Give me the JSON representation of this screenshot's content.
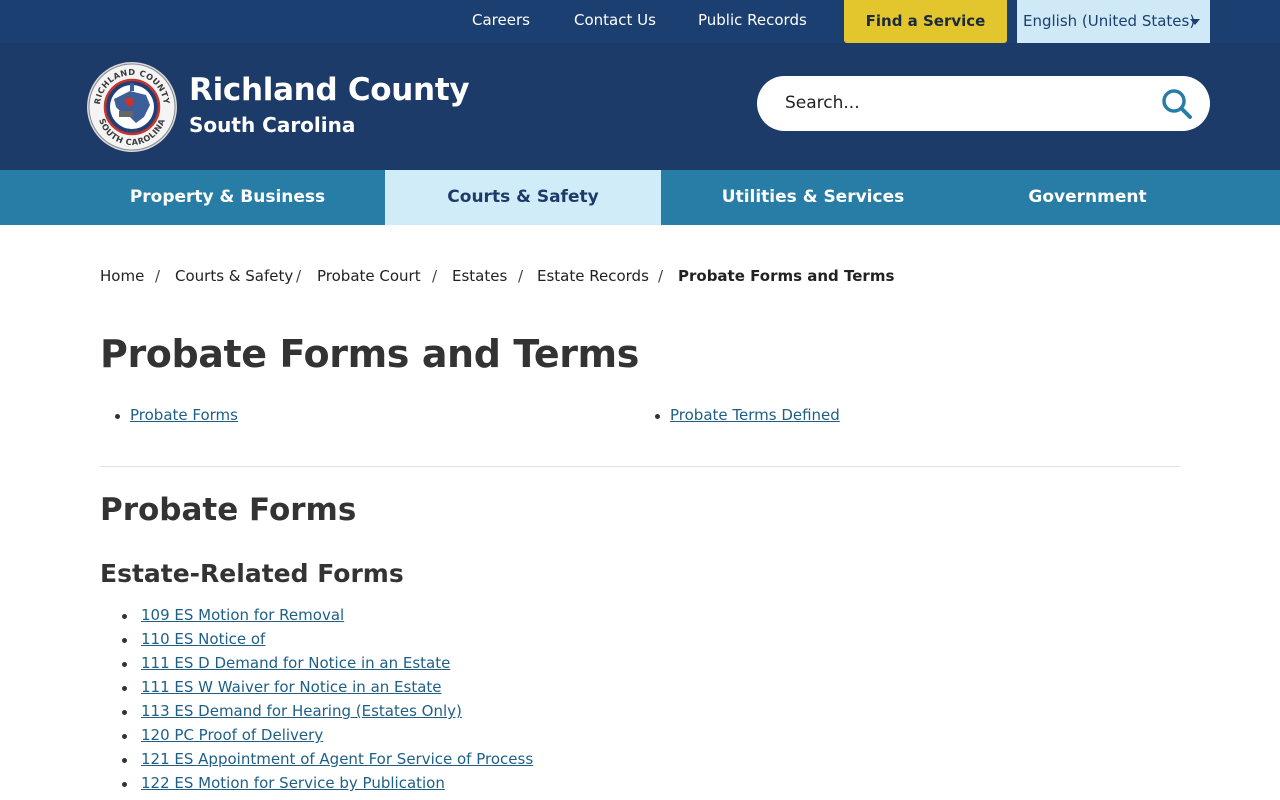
{
  "utility_nav": {
    "links": [
      "Careers",
      "Contact Us",
      "Public Records"
    ],
    "find_service": "Find a Service",
    "language": "English (United States)"
  },
  "header": {
    "title": "Richland County",
    "subtitle": "South Carolina",
    "seal_text_top": "RICHLAND COUNTY",
    "seal_text_bottom": "SOUTH CAROLINA",
    "seal_year": "1799"
  },
  "search": {
    "placeholder": "Search..."
  },
  "main_nav": {
    "items": [
      "Property & Business",
      "Courts & Safety",
      "Utilities & Services",
      "Government"
    ],
    "active": "Courts & Safety"
  },
  "breadcrumb": {
    "items": [
      "Home",
      "Courts & Safety",
      "Probate Court",
      "Estates",
      "Estate Records"
    ],
    "current": "Probate Forms and Terms"
  },
  "page": {
    "title": "Probate Forms and Terms",
    "jump_links": [
      "Probate Forms",
      "Probate Terms Defined"
    ],
    "section_title": "Probate Forms",
    "subsection_title": "Estate-Related Forms",
    "forms": [
      "109 ES Motion for Removal",
      "110 ES Notice of",
      "111 ES D Demand for Notice in an Estate",
      "111 ES W Waiver for Notice in an Estate",
      "113 ES Demand for Hearing (Estates Only)",
      "120 PC Proof of Delivery",
      "121 ES Appointment of Agent For Service of Process",
      "122 ES Motion for Service by Publication"
    ]
  },
  "colors": {
    "utility_bar": "#1b3f70",
    "header_bg": "#1c3b68",
    "nav_bg": "#287da6",
    "nav_active_bg": "#d1ecf9",
    "find_service_bg": "#e3c52d",
    "link": "#1f5f86"
  }
}
